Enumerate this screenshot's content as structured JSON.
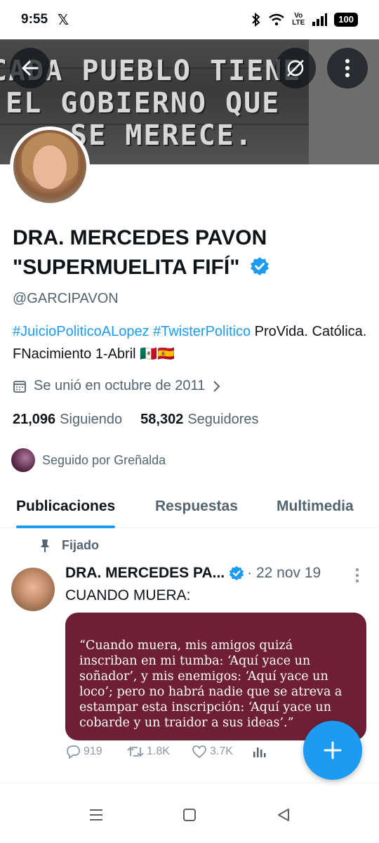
{
  "status_bar": {
    "time": "9:55",
    "app_logo": "𝕏",
    "volte_top": "Vo",
    "volte_bottom": "LTE",
    "battery": "100"
  },
  "banner": {
    "lines": [
      "CADA PUEBLO TIENE",
      "EL GOBIERNO QUE",
      "SE MERECE."
    ]
  },
  "profile": {
    "name": "DRA. MERCEDES PAVON \"SUPERMUELITA FIFÍ\"",
    "handle": "@GARCIPAVON",
    "bio_tag1": "#JuicioPoliticoALopez",
    "bio_tag2": "#TwisterPolitico",
    "bio_text": " ProVida. Católica. FNacimiento 1-Abril 🇲🇽🇪🇸",
    "joined": "Se unió en octubre de 2011",
    "following_count": "21,096",
    "following_label": "Siguiendo",
    "followers_count": "58,302",
    "followers_label": "Seguidores",
    "followed_by": "Seguido por Greñalda"
  },
  "tabs": [
    {
      "label": "Publicaciones"
    },
    {
      "label": "Respuestas"
    },
    {
      "label": "Multimedia"
    }
  ],
  "tweet": {
    "pinned_label": "Fijado",
    "author": "DRA. MERCEDES PA...",
    "date": "· 22 nov 19",
    "text": "CUANDO MUERA:",
    "quote": "“Cuando muera, mis amigos quizá inscriban en mi tumba: ‘Aquí yace un soñador’, y mis enemigos: ‘Aquí yace un loco’; pero no habrá nadie que se atreva a estampar esta inscripción: ‘Aquí yace un cobarde y un traidor a sus ideas’.”",
    "replies": "919",
    "retweets": "1.8K",
    "likes": "3.7K"
  },
  "colors": {
    "accent": "#1d9bf0",
    "quote_bg": "#6e1f35",
    "muted": "#536471"
  }
}
